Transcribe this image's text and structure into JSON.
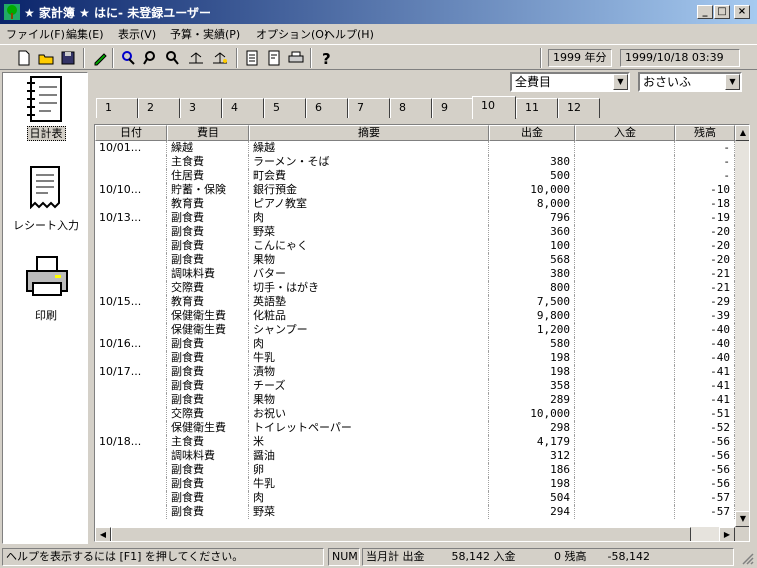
{
  "window": {
    "title": "★ 家計簿 ★ はに- 未登録ユーザー"
  },
  "menu": [
    "ファイル(F)",
    "編集(E)",
    "表示(V)",
    "予算・実績(P)",
    "オプション(O)",
    "ヘルプ(H)"
  ],
  "toolbar": {
    "year": "1999 年分",
    "datetime": "1999/10/18 03:39"
  },
  "sidebar": {
    "items": [
      {
        "label": "日計表",
        "icon": "notebook-icon",
        "selected": true
      },
      {
        "label": "レシート入力",
        "icon": "receipt-icon",
        "selected": false
      },
      {
        "label": "印刷",
        "icon": "printer-icon",
        "selected": false
      }
    ]
  },
  "filters": {
    "category": "全費目",
    "user": "おさいふ"
  },
  "tabs": [
    "1",
    "2",
    "3",
    "4",
    "5",
    "6",
    "7",
    "8",
    "9",
    "10",
    "11",
    "12"
  ],
  "active_tab": "10",
  "table": {
    "columns": [
      "日付",
      "費目",
      "摘要",
      "出金",
      "入金",
      "残高"
    ],
    "rows": [
      [
        "10/01...",
        "繰越",
        "繰越",
        "",
        "",
        "-"
      ],
      [
        "",
        "主食費",
        "ラーメン・そば",
        "380",
        "",
        "-"
      ],
      [
        "",
        "住居費",
        "町会費",
        "500",
        "",
        "-"
      ],
      [
        "10/10...",
        "貯蓄・保険",
        "銀行預金",
        "10,000",
        "",
        "-10"
      ],
      [
        "",
        "教育費",
        "ピアノ教室",
        "8,000",
        "",
        "-18"
      ],
      [
        "10/13...",
        "副食費",
        "肉",
        "796",
        "",
        "-19"
      ],
      [
        "",
        "副食費",
        "野菜",
        "360",
        "",
        "-20"
      ],
      [
        "",
        "副食費",
        "こんにゃく",
        "100",
        "",
        "-20"
      ],
      [
        "",
        "副食費",
        "果物",
        "568",
        "",
        "-20"
      ],
      [
        "",
        "調味料費",
        "バター",
        "380",
        "",
        "-21"
      ],
      [
        "",
        "交際費",
        "切手・はがき",
        "800",
        "",
        "-21"
      ],
      [
        "10/15...",
        "教育費",
        "英語塾",
        "7,500",
        "",
        "-29"
      ],
      [
        "",
        "保健衛生費",
        "化粧品",
        "9,800",
        "",
        "-39"
      ],
      [
        "",
        "保健衛生費",
        "シャンプー",
        "1,200",
        "",
        "-40"
      ],
      [
        "10/16...",
        "副食費",
        "肉",
        "580",
        "",
        "-40"
      ],
      [
        "",
        "副食費",
        "牛乳",
        "198",
        "",
        "-40"
      ],
      [
        "10/17...",
        "副食費",
        "漬物",
        "198",
        "",
        "-41"
      ],
      [
        "",
        "副食費",
        "チーズ",
        "358",
        "",
        "-41"
      ],
      [
        "",
        "副食費",
        "果物",
        "289",
        "",
        "-41"
      ],
      [
        "",
        "交際費",
        "お祝い",
        "10,000",
        "",
        "-51"
      ],
      [
        "",
        "保健衛生費",
        "トイレットペーパー",
        "298",
        "",
        "-52"
      ],
      [
        "10/18...",
        "主食費",
        "米",
        "4,179",
        "",
        "-56"
      ],
      [
        "",
        "調味料費",
        "醤油",
        "312",
        "",
        "-56"
      ],
      [
        "",
        "副食費",
        "卵",
        "186",
        "",
        "-56"
      ],
      [
        "",
        "副食費",
        "牛乳",
        "198",
        "",
        "-56"
      ],
      [
        "",
        "副食費",
        "肉",
        "504",
        "",
        "-57"
      ],
      [
        "",
        "副食費",
        "野菜",
        "294",
        "",
        "-57"
      ]
    ]
  },
  "status": {
    "help": "ヘルプを表示するには [F1] を押してください。",
    "num": "NUM",
    "monthly_label": "当月計 出金",
    "out_total": "58,142",
    "in_label": "入金",
    "in_total": "0",
    "balance_label": "残高",
    "balance": "-58,142"
  }
}
